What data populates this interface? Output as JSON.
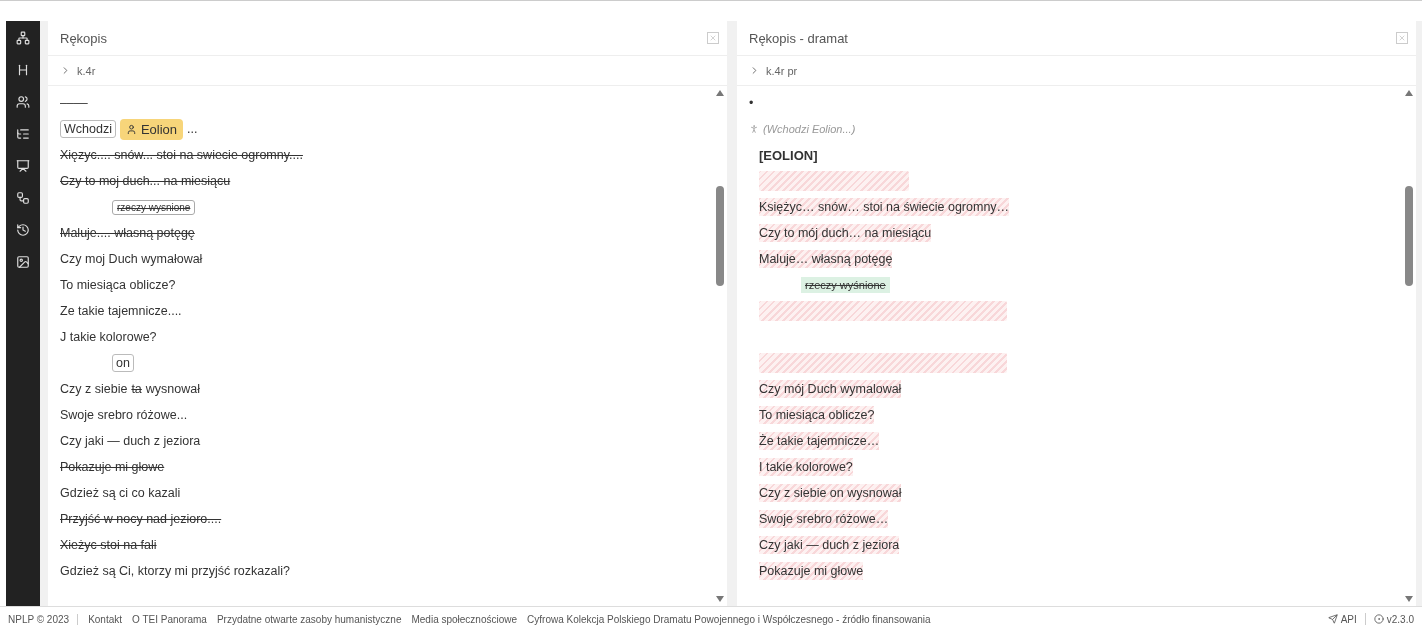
{
  "panels": [
    {
      "title": "Rękopis",
      "breadcrumb": "k.4r",
      "lines": [
        {
          "segments": [
            {
              "kind": "plain",
              "text": "––––"
            }
          ]
        },
        {
          "segments": [
            {
              "kind": "boxed",
              "text": "Wchodzi"
            },
            {
              "kind": "person",
              "text": "Eolion"
            },
            {
              "kind": "plain",
              "text": "..."
            }
          ]
        },
        {
          "segments": [
            {
              "kind": "deleted",
              "text": "Xięzyc.... snów... stoi na swiecie ogromny...."
            }
          ]
        },
        {
          "segments": [
            {
              "kind": "deleted",
              "text": "Czy to moj duch... na miesiącu"
            }
          ]
        },
        {
          "indented": true,
          "segments": [
            {
              "kind": "added",
              "text": "rzeczy wysnione"
            }
          ]
        },
        {
          "segments": [
            {
              "kind": "deleted",
              "text": "Maluje.... własną potęgę"
            }
          ]
        },
        {
          "segments": [
            {
              "kind": "plain",
              "text": "Czy moj Duch wymałował"
            }
          ]
        },
        {
          "segments": [
            {
              "kind": "plain",
              "text": "To miesiąca oblicze?"
            }
          ]
        },
        {
          "segments": [
            {
              "kind": "plain",
              "text": "Ze takie tajemnicze...."
            }
          ]
        },
        {
          "segments": [
            {
              "kind": "plain",
              "text": "J takie kolorowe?"
            }
          ]
        },
        {
          "indented": true,
          "segments": [
            {
              "kind": "boxed",
              "text": "on"
            }
          ]
        },
        {
          "segments": [
            {
              "kind": "plain",
              "text": "Czy z siebie"
            },
            {
              "kind": "deleted",
              "text": "ta"
            },
            {
              "kind": "plain",
              "text": "wysnował"
            }
          ]
        },
        {
          "segments": [
            {
              "kind": "plain",
              "text": "Swoje srebro różowe..."
            }
          ]
        },
        {
          "segments": [
            {
              "kind": "plain",
              "text": "Czy jaki — duch z jeziora"
            }
          ]
        },
        {
          "segments": [
            {
              "kind": "deleted",
              "text": "Pokazuje mi głowe"
            }
          ]
        },
        {
          "segments": [
            {
              "kind": "plain",
              "text": "Gdzież są ci co kazali"
            }
          ]
        },
        {
          "segments": [
            {
              "kind": "deleted",
              "text": "Przyjść w nocy nad jezioro...."
            }
          ]
        },
        {
          "segments": [
            {
              "kind": "deleted",
              "text": "Xieżyc stoi na fali"
            }
          ]
        },
        {
          "segments": [
            {
              "kind": "plain",
              "text": "Gdzież są Ci, ktorzy mi przyjść rozkazali?"
            }
          ]
        }
      ]
    },
    {
      "title": "Rękopis - dramat",
      "breadcrumb": "k.4r pr",
      "lines": [
        {
          "segments": [
            {
              "kind": "plain",
              "text": "•"
            }
          ]
        },
        {
          "segments": [
            {
              "kind": "stage",
              "text": "(Wchodzi Eolion...)"
            }
          ]
        },
        {
          "segments": [
            {
              "kind": "speaker",
              "text": "[EOLION]"
            }
          ]
        },
        {
          "segments": [
            {
              "kind": "hatched-empty"
            }
          ]
        },
        {
          "segments": [
            {
              "kind": "hatched",
              "text": "Księżyc… snów… stoi na świecie ogromny…"
            }
          ]
        },
        {
          "segments": [
            {
              "kind": "hatched",
              "text": "Czy to mój duch… na miesiącu"
            }
          ]
        },
        {
          "segments": [
            {
              "kind": "hatched",
              "text": "Maluje… własną potęgę"
            }
          ]
        },
        {
          "indented": true,
          "segments": [
            {
              "kind": "added-deleted",
              "text": "rzeczy wyśnione"
            }
          ]
        },
        {
          "segments": [
            {
              "kind": "hatched-empty"
            }
          ]
        },
        {
          "segments": [
            {
              "kind": "blank"
            }
          ]
        },
        {
          "segments": [
            {
              "kind": "hatched-empty"
            }
          ]
        },
        {
          "segments": [
            {
              "kind": "hatched",
              "text": "Czy mój Duch wymalował"
            }
          ]
        },
        {
          "segments": [
            {
              "kind": "hatched",
              "text": "To miesiąca oblicze?"
            }
          ]
        },
        {
          "segments": [
            {
              "kind": "hatched",
              "text": "Że takie tajemnicze…"
            }
          ]
        },
        {
          "segments": [
            {
              "kind": "hatched",
              "text": "I takie kolorowe?"
            }
          ]
        },
        {
          "segments": [
            {
              "kind": "hatched",
              "text": "Czy z siebie on wysnował"
            }
          ]
        },
        {
          "segments": [
            {
              "kind": "hatched",
              "text": "Swoje srebro różowe…"
            }
          ]
        },
        {
          "segments": [
            {
              "kind": "hatched",
              "text": "Czy jaki — duch z jeziora"
            }
          ]
        },
        {
          "segments": [
            {
              "kind": "hatched",
              "text": "Pokazuje mi głowe"
            }
          ]
        }
      ]
    }
  ],
  "footer": {
    "copyright": "NPLP © 2023",
    "links": [
      "Kontakt",
      "O TEI Panorama",
      "Przydatne otwarte zasoby humanistyczne",
      "Media społecznościowe",
      "Cyfrowa Kolekcja Polskiego Dramatu Powojennego i Współczesnego - źródło finansowania"
    ],
    "api": "API",
    "version": "v2.3.0"
  }
}
